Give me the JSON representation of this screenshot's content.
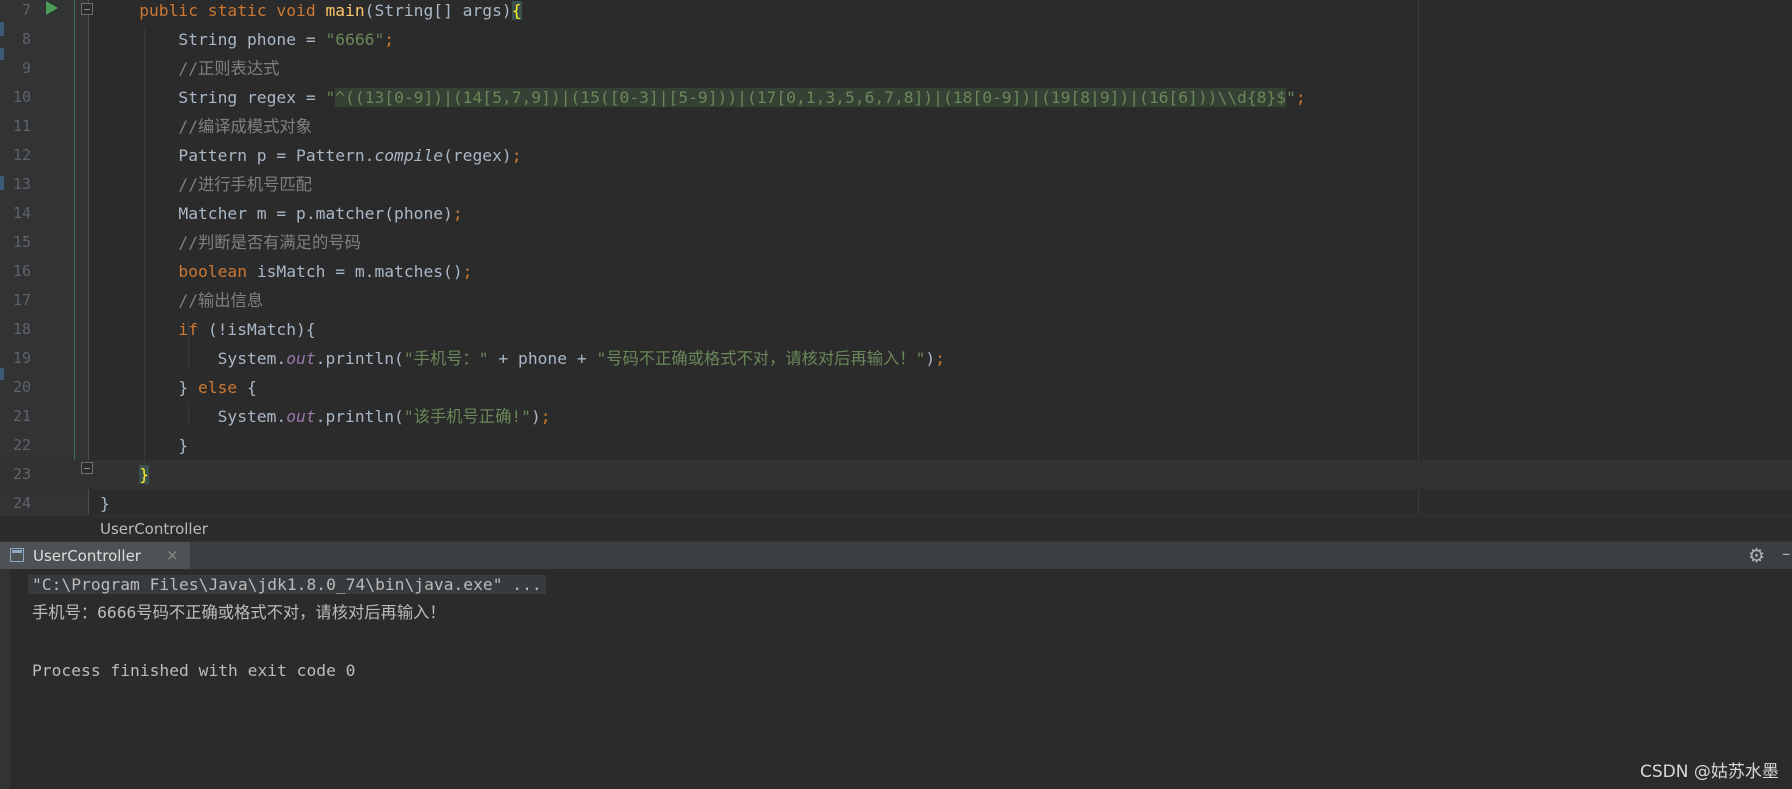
{
  "editor": {
    "lines": [
      {
        "num": "7",
        "tokens": [
          [
            "kw",
            "public static void "
          ],
          [
            "fn",
            "main"
          ],
          [
            "",
            "(String[] args)"
          ],
          [
            "brmatch",
            "{"
          ]
        ]
      },
      {
        "num": "8",
        "tokens": [
          [
            "",
            "String phone = "
          ],
          [
            "st",
            "\"6666\""
          ],
          [
            "kw",
            ";"
          ]
        ]
      },
      {
        "num": "9",
        "tokens": [
          [
            "cm",
            "//正则表达式"
          ]
        ]
      },
      {
        "num": "10",
        "tokens": [
          [
            "",
            "String regex = "
          ],
          [
            "st",
            "\""
          ],
          [
            "rx",
            "^((13[0-9])|(14[5,7,9])|(15([0-3]|[5-9]))|(17[0,1,3,5,6,7,8])|(18[0-9])|(19[8|9])|(16[6]))\\\\d{8}$"
          ],
          [
            "st",
            "\""
          ],
          [
            "kw",
            ";"
          ]
        ]
      },
      {
        "num": "11",
        "tokens": [
          [
            "cm",
            "//编译成模式对象"
          ]
        ]
      },
      {
        "num": "12",
        "tokens": [
          [
            "",
            "Pattern p = Pattern."
          ],
          [
            "it",
            "compile"
          ],
          [
            "",
            "(regex)"
          ],
          [
            "kw",
            ";"
          ]
        ]
      },
      {
        "num": "13",
        "tokens": [
          [
            "cm",
            "//进行手机号匹配"
          ]
        ]
      },
      {
        "num": "14",
        "tokens": [
          [
            "",
            "Matcher m = p.matcher(phone)"
          ],
          [
            "kw",
            ";"
          ]
        ]
      },
      {
        "num": "15",
        "tokens": [
          [
            "cm",
            "//判断是否有满足的号码"
          ]
        ]
      },
      {
        "num": "16",
        "tokens": [
          [
            "kw",
            "boolean "
          ],
          [
            "",
            "isMatch = m.matches()"
          ],
          [
            "kw",
            ";"
          ]
        ]
      },
      {
        "num": "17",
        "tokens": [
          [
            "cm",
            "//输出信息"
          ]
        ]
      },
      {
        "num": "18",
        "tokens": [
          [
            "kw",
            "if "
          ],
          [
            "",
            "(!isMatch){"
          ]
        ]
      },
      {
        "num": "19",
        "tokens": [
          [
            "",
            "System."
          ],
          [
            "sf",
            "out"
          ],
          [
            "",
            ".println("
          ],
          [
            "st",
            "\"手机号：\""
          ],
          [
            "",
            " + phone + "
          ],
          [
            "st",
            "\"号码不正确或格式不对，请核对后再输入！\""
          ],
          [
            "",
            ")"
          ],
          [
            "kw",
            ";"
          ]
        ]
      },
      {
        "num": "20",
        "tokens": [
          [
            "",
            "} "
          ],
          [
            "kw",
            "else "
          ],
          [
            "",
            "{"
          ]
        ]
      },
      {
        "num": "21",
        "tokens": [
          [
            "",
            "System."
          ],
          [
            "sf",
            "out"
          ],
          [
            "",
            ".println("
          ],
          [
            "st",
            "\"该手机号正确!\""
          ],
          [
            "",
            ")"
          ],
          [
            "kw",
            ";"
          ]
        ]
      },
      {
        "num": "22",
        "tokens": [
          [
            "",
            "}"
          ]
        ]
      },
      {
        "num": "23",
        "tokens": [
          [
            "brmatch",
            "}"
          ]
        ]
      },
      {
        "num": "24",
        "tokens": [
          [
            "",
            "}"
          ]
        ]
      }
    ]
  },
  "breadcrumb": {
    "label": "UserController"
  },
  "run_panel": {
    "tab_label": "UserController",
    "close_glyph": "×",
    "gear_glyph": "⚙",
    "minimize_glyph": "–",
    "console": {
      "command": "\"C:\\Program Files\\Java\\jdk1.8.0_74\\bin\\java.exe\" ...",
      "output": "手机号：6666号码不正确或格式不对，请核对后再输入！",
      "exit": "Process finished with exit code 0"
    }
  },
  "watermark": "CSDN @姑苏水墨"
}
